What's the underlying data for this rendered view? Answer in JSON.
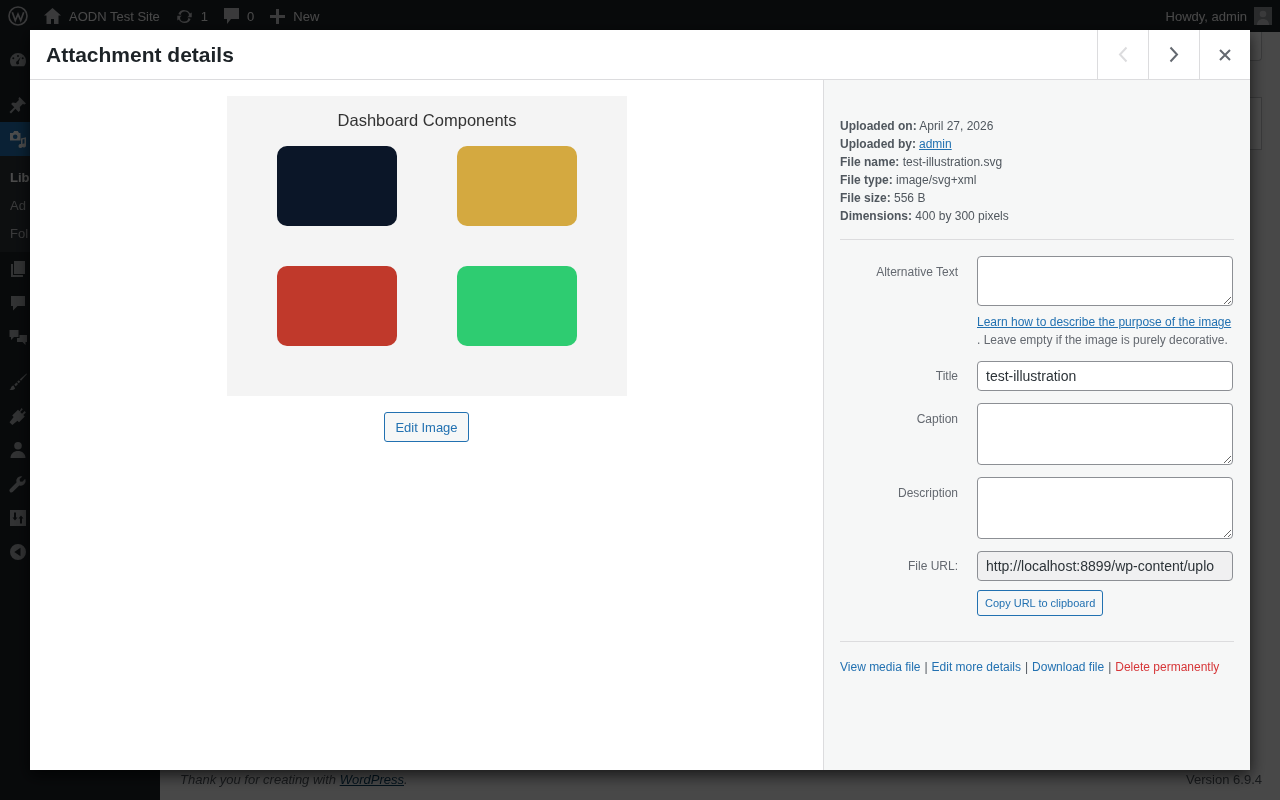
{
  "admin_bar": {
    "site_name": "AODN Test Site",
    "updates": "1",
    "comments": "0",
    "new": "New",
    "greeting": "Howdy, admin"
  },
  "sidebar": {
    "groups": [
      {
        "items": [
          {
            "kind": "dashboard",
            "selected": false
          }
        ]
      },
      {
        "items": [
          {
            "kind": "posts",
            "selected": false
          },
          {
            "kind": "media",
            "selected": true,
            "submenu": [
              {
                "label": "Lib",
                "selected": true
              },
              {
                "label": "Ad",
                "selected": false
              },
              {
                "label": "Fol",
                "selected": false
              }
            ]
          },
          {
            "kind": "pages",
            "selected": false
          },
          {
            "kind": "comments",
            "selected": false
          },
          {
            "kind": "feedback",
            "selected": false
          }
        ]
      },
      {
        "items": [
          {
            "kind": "appearance",
            "selected": false
          },
          {
            "kind": "plugins",
            "selected": false
          },
          {
            "kind": "users",
            "selected": false
          },
          {
            "kind": "tools",
            "selected": false
          },
          {
            "kind": "settings",
            "selected": false
          },
          {
            "kind": "collapse",
            "selected": false
          }
        ]
      }
    ]
  },
  "footer": {
    "text": "Thank you for creating with ",
    "link": "WordPress",
    "end": ".",
    "version": "Version 6.9.4"
  },
  "modal": {
    "title": "Attachment details",
    "nav": [
      {
        "kind": "previous",
        "disabled": true
      },
      {
        "kind": "next",
        "disabled": false
      },
      {
        "kind": "close",
        "disabled": false
      }
    ],
    "preview": {
      "image_title": "Dashboard Components",
      "tiles": [
        {
          "color": "#0b1628"
        },
        {
          "color": "#d4a940"
        },
        {
          "color": "#c0392b"
        },
        {
          "color": "#2ecc71"
        }
      ],
      "edit_button": "Edit Image"
    },
    "details": {
      "info": [
        {
          "text": "**Uploaded on:** April 27, 2026"
        },
        {
          "text": "**Uploaded by:**",
          "link": "admin"
        },
        {
          "text": "**File name:** test-illustration.svg"
        },
        {
          "text": "**File type:** image/svg+xml"
        },
        {
          "text": "**File size:** 556 B"
        },
        {
          "text": "**Dimensions:** 400 by 300 pixels"
        }
      ],
      "fields": [
        {
          "label": "Alternative Text",
          "kind": "textarea",
          "readonly": false,
          "help_link": "Learn how to describe the purpose of the image",
          "help_text": ". Leave empty if the image is purely decorative."
        },
        {
          "label": "Title",
          "kind": "input",
          "readonly": false,
          "value": "test-illustration"
        },
        {
          "label": "Caption",
          "kind": "textarea",
          "readonly": false
        },
        {
          "label": "Description",
          "kind": "textarea",
          "readonly": false
        },
        {
          "label": "File URL:",
          "kind": "input",
          "readonly": true,
          "value": "http://localhost:8899/wp-content/uplo",
          "button": "Copy URL to clipboard"
        }
      ],
      "actions": [
        {
          "kind": "link",
          "label": "View media file"
        },
        {
          "kind": "separator",
          "label": "|"
        },
        {
          "kind": "link",
          "label": "Edit more details"
        },
        {
          "kind": "separator",
          "label": "|"
        },
        {
          "kind": "link",
          "label": "Download file"
        },
        {
          "kind": "separator",
          "label": "|"
        },
        {
          "kind": "danger",
          "label": "Delete permanently"
        }
      ]
    }
  }
}
